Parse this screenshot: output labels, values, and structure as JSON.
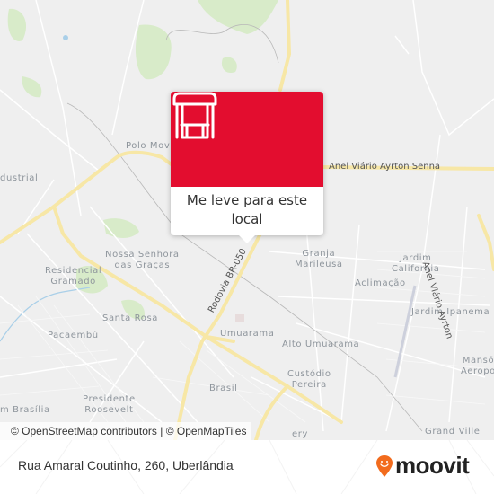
{
  "map": {
    "places": [
      {
        "name": "Polo Moveleiro",
        "text": "Polo Mov"
      },
      {
        "name": "Industrial",
        "text": "dustrial"
      },
      {
        "name": "Nossa Senhora das Graças",
        "line1": "Nossa Senhora",
        "line2": "das Graças"
      },
      {
        "name": "Residencial Gramado",
        "line1": "Residencial",
        "line2": "Gramado"
      },
      {
        "name": "Santa Rosa",
        "text": "Santa Rosa"
      },
      {
        "name": "Pacaembú",
        "text": "Pacaembú"
      },
      {
        "name": "Jardim Brasília",
        "text": "m Brasília"
      },
      {
        "name": "Presidente Roosevelt",
        "line1": "Presidente",
        "line2": "Roosevelt"
      },
      {
        "name": "Brasil",
        "text": "Brasil"
      },
      {
        "name": "Umuarama",
        "text": "Umuarama"
      },
      {
        "name": "Alto Umuarama",
        "text": "Alto Umuarama"
      },
      {
        "name": "Custódio Pereira",
        "line1": "Custódio",
        "line2": "Pereira"
      },
      {
        "name": "Granja Marileusa",
        "line1": "Granja",
        "line2": "Marileusa"
      },
      {
        "name": "Jardim California",
        "line1": "Jardim",
        "line2": "California"
      },
      {
        "name": "Aclimação",
        "text": "Aclimação"
      },
      {
        "name": "Jardim Ipanema",
        "text": "Jardim Ipanema"
      },
      {
        "name": "Mansões Aeroporto",
        "line1": "Mansõ",
        "line2": "Aeropo"
      },
      {
        "name": "Grand Ville",
        "text": "Grand Ville"
      },
      {
        "name": "partial",
        "text": "ery"
      }
    ],
    "roads": {
      "anel_viario": "Anel Viário Ayrton Senna",
      "anel_viario_vertical": "Anel Viário Ayrton",
      "rodovia": "Rodovia BR-050"
    },
    "colors": {
      "background": "#efefef",
      "major_road": "#f7e7a6",
      "park": "#d4e9c3",
      "water": "#a9cfe8"
    }
  },
  "popup": {
    "icon": "bus-stop-icon",
    "label": "Me leve para este local",
    "color": "#e30d2f"
  },
  "attribution": "© OpenStreetMap contributors | © OpenMapTiles",
  "footer": {
    "address": "Rua Amaral Coutinho, 260, Uberlândia",
    "brand": "moovit",
    "brand_color": "#f26b1d"
  }
}
